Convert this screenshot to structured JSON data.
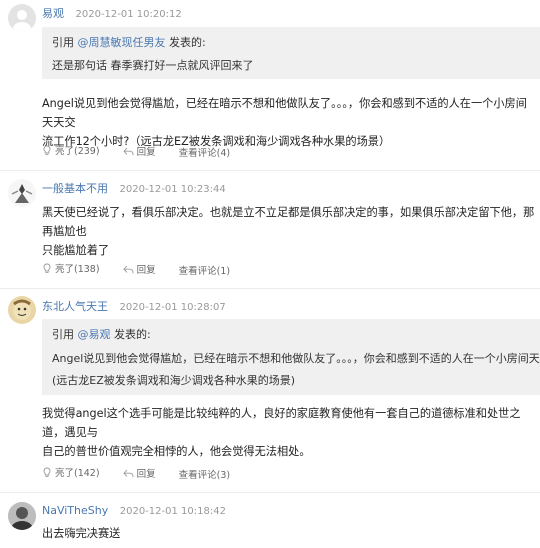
{
  "comments": [
    {
      "user": "易观",
      "time": "2020-12-01 10:20:12",
      "quote": {
        "prefix": "引用 ",
        "at_user": "@周慧敏现任男友",
        "suffix": " 发表的:",
        "lines": [
          "还是那句话 春季赛打好一点就风评回来了"
        ]
      },
      "body": [
        "Angel说见到他会觉得尴尬，已经在暗示不想和他做队友了。。。，你会和感到不适的人在一个小房间天天交",
        "流工作12个小时?（远古龙EZ被发条调戏和海少调戏各种水果的场景）"
      ],
      "likes": "亮了(239)",
      "reply": "回复",
      "view": "查看评论(4)"
    },
    {
      "user": "一般基本不用",
      "time": "2020-12-01 10:23:44",
      "body": [
        "黑天使已经说了，看俱乐部决定。也就是立不立足都是俱乐部决定的事，如果俱乐部决定留下他，那再尴尬也",
        "只能尴尬着了"
      ],
      "likes": "亮了(138)",
      "reply": "回复",
      "view": "查看评论(1)"
    },
    {
      "user": "东北人气天王",
      "time": "2020-12-01 10:28:07",
      "quote": {
        "prefix": "引用 ",
        "at_user": "@易观",
        "suffix": " 发表的:",
        "lines": [
          "Angel说见到他会觉得尴尬，已经在暗示不想和他做队友了。。。，你会和感到不适的人在一个小房间天天交流",
          "(远古龙EZ被发条调戏和海少调戏各种水果的场景)"
        ]
      },
      "body": [
        "我觉得angel这个选手可能是比较纯粹的人，良好的家庭教育使他有一套自己的道德标准和处世之道，遇见与",
        "自己的普世价值观完全相悖的人，他会觉得无法相处。"
      ],
      "likes": "亮了(142)",
      "reply": "回复",
      "view": "查看评论(3)"
    },
    {
      "user": "NaViTheShy",
      "time": "2020-12-01 10:18:42",
      "body": [
        "出去嗨完决赛送"
      ]
    }
  ]
}
